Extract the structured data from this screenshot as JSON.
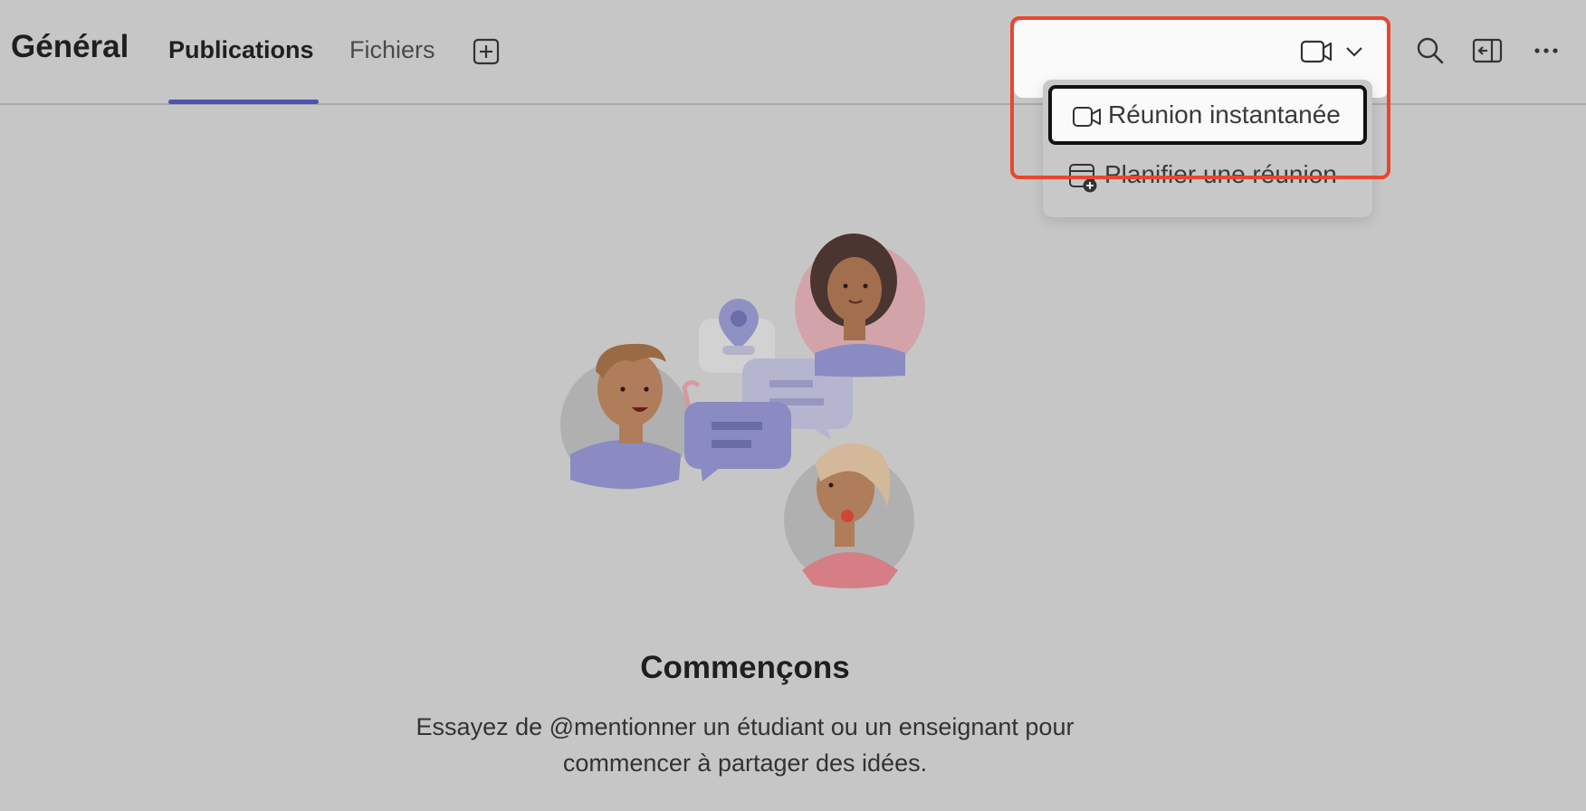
{
  "header": {
    "channel_title": "Général",
    "tabs": [
      {
        "label": "Publications",
        "active": true
      },
      {
        "label": "Fichiers",
        "active": false
      }
    ],
    "add_tab_icon": "plus-square-icon",
    "actions": [
      "video-icon",
      "chevron-down-icon",
      "search-icon",
      "side-panel-icon",
      "more-icon"
    ]
  },
  "meet_menu": {
    "items": [
      {
        "label": "Réunion instantanée",
        "icon": "video-icon"
      },
      {
        "label": "Planifier une réunion",
        "icon": "calendar-add-icon"
      }
    ]
  },
  "empty_state": {
    "title": "Commençons",
    "line1": "Essayez de @mentionner un étudiant ou un enseignant pour",
    "line2": "commencer à partager des idées."
  },
  "colors": {
    "accent": "#4f52b2",
    "highlight": "#e8472f",
    "background": "#c6c6c6"
  }
}
